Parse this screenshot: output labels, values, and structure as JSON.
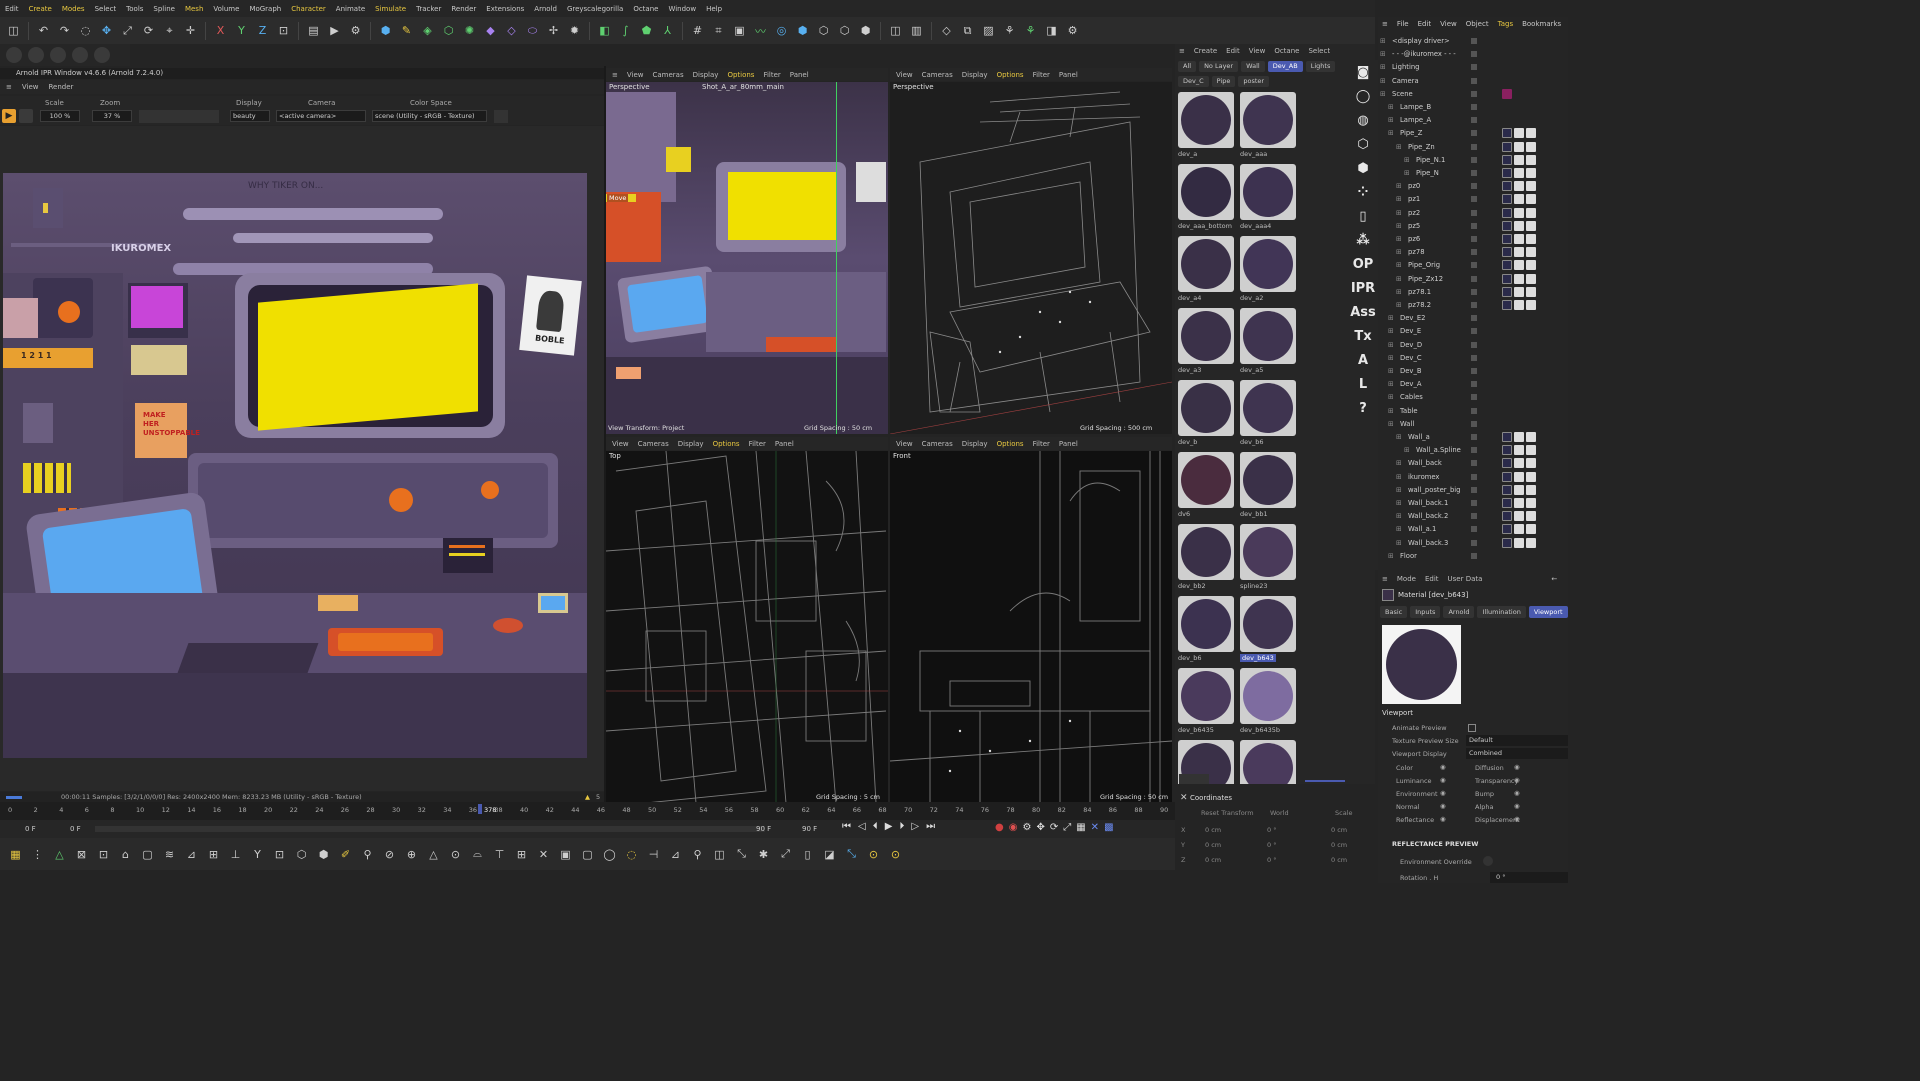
{
  "menu": [
    "Edit",
    "Create",
    "Modes",
    "Select",
    "Tools",
    "Spline",
    "Mesh",
    "Volume",
    "MoGraph",
    "Character",
    "Animate",
    "Simulate",
    "Tracker",
    "Render",
    "Extensions",
    "Arnold",
    "Greyscalegorilla",
    "Octane",
    "Window",
    "Help"
  ],
  "ipr": {
    "title": "Arnold IPR Window v4.6.6 (Arnold 7.2.4.0)",
    "menu": [
      "View",
      "Render"
    ],
    "labels": {
      "scale": "Scale",
      "zoom": "Zoom",
      "display": "Display",
      "camera": "Camera",
      "colorspace": "Color Space"
    },
    "scale_value": "100 %",
    "zoom_value": "37 %",
    "display_value": "beauty",
    "camera_value": "<active camera>",
    "colorspace_value": "scene (Utility - sRGB - Texture)",
    "status": "00:00:11   Samples: [3/2/1/0/0/0]   Res: 2400x2400   Mem: 8233.23 MB   (Utility - sRGB - Texture)",
    "warn_count": "5",
    "scene_text": {
      "brand": "IKUROMEX",
      "sign": "MAKE HER UNSTOPPABLE",
      "poster": "BOBLE",
      "wall": "WHY TIKER ON...",
      "nums": "1 2 1 1"
    }
  },
  "viewports": [
    {
      "menu": [
        "View",
        "Cameras",
        "Display",
        "Options",
        "Filter",
        "Panel"
      ],
      "name": "Perspective",
      "camera": "Shot_A_ar_80mm_main",
      "footer_left": "View Transform: Project",
      "footer_right": "Grid Spacing : 50 cm",
      "move": "Move"
    },
    {
      "menu": [
        "View",
        "Cameras",
        "Display",
        "Options",
        "Filter",
        "Panel"
      ],
      "name": "Perspective",
      "footer_right": "Grid Spacing : 500 cm"
    },
    {
      "menu": [
        "View",
        "Cameras",
        "Display",
        "Options",
        "Filter",
        "Panel"
      ],
      "name": "Top",
      "footer_right": "Grid Spacing : 5 cm"
    },
    {
      "menu": [
        "View",
        "Cameras",
        "Display",
        "Options",
        "Filter",
        "Panel"
      ],
      "name": "Front",
      "footer_right": "Grid Spacing : 50 cm"
    }
  ],
  "materials": {
    "menu": [
      "Create",
      "Edit",
      "View",
      "Octane",
      "Select"
    ],
    "tabs_row1": [
      "All",
      "No Layer",
      "Wall",
      "Dev_AB",
      "Lights"
    ],
    "tabs_row2": [
      "Dev_C",
      "Pipe",
      "poster"
    ],
    "items": [
      {
        "name": "dev_a",
        "color": "#3a3048"
      },
      {
        "name": "dev_aaa",
        "color": "#3f3450"
      },
      {
        "name": "dev_aaa_bottom",
        "color": "#332b42"
      },
      {
        "name": "dev_aaa4",
        "color": "#3d3250"
      },
      {
        "name": "dev_a4",
        "color": "#3a3048"
      },
      {
        "name": "dev_a2",
        "color": "#413556"
      },
      {
        "name": "dev_a3",
        "color": "#3b3149"
      },
      {
        "name": "dev_a5",
        "color": "#3f3450"
      },
      {
        "name": "dev_b",
        "color": "#393046"
      },
      {
        "name": "dev_b6",
        "color": "#3f3450"
      },
      {
        "name": "dv6",
        "color": "#4a2c3e"
      },
      {
        "name": "dev_bb1",
        "color": "#3a3048"
      },
      {
        "name": "dev_bb2",
        "color": "#3a3048"
      },
      {
        "name": "spline23",
        "color": "#4a3a5a"
      },
      {
        "name": "dev_b6",
        "color": "#3c3250"
      },
      {
        "name": "dev_b643",
        "color": "#3f3450"
      },
      {
        "name": "dev_b6435",
        "color": "#4a3a5c"
      },
      {
        "name": "dev_b6435b",
        "color": "#7e6ca0"
      },
      {
        "name": "",
        "color": "#3a3048"
      },
      {
        "name": "",
        "color": "#4a3a5c"
      }
    ]
  },
  "side_icons": [
    "OP",
    "IPR",
    "Ass",
    "Tx",
    "A",
    "L",
    "?"
  ],
  "objects": {
    "menu": [
      "File",
      "Edit",
      "View",
      "Object",
      "Tags",
      "Bookmarks"
    ],
    "rows": [
      {
        "label": "<display driver>",
        "indent": 1
      },
      {
        "label": "- - -@ikuromex - - -",
        "indent": 1
      },
      {
        "label": "Lighting",
        "indent": 1
      },
      {
        "label": "Camera",
        "indent": 1
      },
      {
        "label": "Scene",
        "indent": 1
      },
      {
        "label": "Lampe_B",
        "indent": 2
      },
      {
        "label": "Lampe_A",
        "indent": 2
      },
      {
        "label": "Pipe_Z",
        "indent": 2
      },
      {
        "label": "Pipe_Zn",
        "indent": 3
      },
      {
        "label": "Pipe_N.1",
        "indent": 4
      },
      {
        "label": "Pipe_N",
        "indent": 4
      },
      {
        "label": "pz0",
        "indent": 3
      },
      {
        "label": "pz1",
        "indent": 3
      },
      {
        "label": "pz2",
        "indent": 3
      },
      {
        "label": "pz5",
        "indent": 3
      },
      {
        "label": "pz6",
        "indent": 3
      },
      {
        "label": "pz78",
        "indent": 3
      },
      {
        "label": "Pipe_Orig",
        "indent": 3
      },
      {
        "label": "Pipe_Zx12",
        "indent": 3
      },
      {
        "label": "pz78.1",
        "indent": 3
      },
      {
        "label": "pz78.2",
        "indent": 3
      },
      {
        "label": "Dev_E2",
        "indent": 2
      },
      {
        "label": "Dev_E",
        "indent": 2
      },
      {
        "label": "Dev_D",
        "indent": 2
      },
      {
        "label": "Dev_C",
        "indent": 2
      },
      {
        "label": "Dev_B",
        "indent": 2
      },
      {
        "label": "Dev_A",
        "indent": 2
      },
      {
        "label": "Cables",
        "indent": 2
      },
      {
        "label": "Table",
        "indent": 2
      },
      {
        "label": "Wall",
        "indent": 2
      },
      {
        "label": "Wall_a",
        "indent": 3
      },
      {
        "label": "Wall_a.Spline",
        "indent": 4
      },
      {
        "label": "Wall_back",
        "indent": 3
      },
      {
        "label": "ikuromex",
        "indent": 3
      },
      {
        "label": "wall_poster_big",
        "indent": 3
      },
      {
        "label": "Wall_back.1",
        "indent": 3
      },
      {
        "label": "Wall_back.2",
        "indent": 3
      },
      {
        "label": "Wall_a.1",
        "indent": 3
      },
      {
        "label": "Wall_back.3",
        "indent": 3
      },
      {
        "label": "Floor",
        "indent": 2
      }
    ]
  },
  "attributes": {
    "menu": [
      "Mode",
      "Edit",
      "User Data"
    ],
    "title": "Material [dev_b643]",
    "tabs": [
      "Basic",
      "Inputs",
      "Arnold",
      "Illumination",
      "Viewport"
    ],
    "section": "Viewport",
    "rows": [
      {
        "label": "Animate Preview",
        "value": ""
      },
      {
        "label": "Texture Preview Size",
        "value": "Default"
      },
      {
        "label": "Viewport Display",
        "value": "Combined"
      }
    ],
    "channels_left": [
      "Color",
      "Luminance",
      "Environment",
      "Normal",
      "Reflectance"
    ],
    "channels_right": [
      "Diffusion",
      "Transparency",
      "Bump",
      "Alpha",
      "Displacement"
    ],
    "reflectance_preview": "REFLECTANCE PREVIEW",
    "env_override": "Environment Override",
    "rotation": "Rotation . H",
    "rotation_value": "0 °"
  },
  "timeline": {
    "ticks": [
      "0",
      "2",
      "4",
      "6",
      "8",
      "10",
      "12",
      "14",
      "16",
      "18",
      "20",
      "22",
      "24",
      "26",
      "28",
      "30",
      "32",
      "34",
      "36",
      "38",
      "40",
      "42",
      "44",
      "46",
      "48",
      "50",
      "52",
      "54",
      "56",
      "58",
      "60",
      "62",
      "64",
      "66",
      "68",
      "70",
      "72",
      "74",
      "76",
      "78",
      "80",
      "82",
      "84",
      "86",
      "88",
      "90"
    ],
    "current": "378",
    "start": "0 F",
    "start2": "0 F",
    "end": "90 F",
    "end2": "90 F"
  },
  "coordinates": {
    "title": "Coordinates",
    "reset": "Reset Transform",
    "world": "World",
    "scale": "Scale",
    "rows": [
      {
        "axis": "X",
        "pos": "0 cm",
        "rot": "0 °",
        "size": "0 cm"
      },
      {
        "axis": "Y",
        "pos": "0 cm",
        "rot": "0 °",
        "size": "0 cm"
      },
      {
        "axis": "Z",
        "pos": "0 cm",
        "rot": "0 °",
        "size": "0 cm"
      }
    ]
  }
}
